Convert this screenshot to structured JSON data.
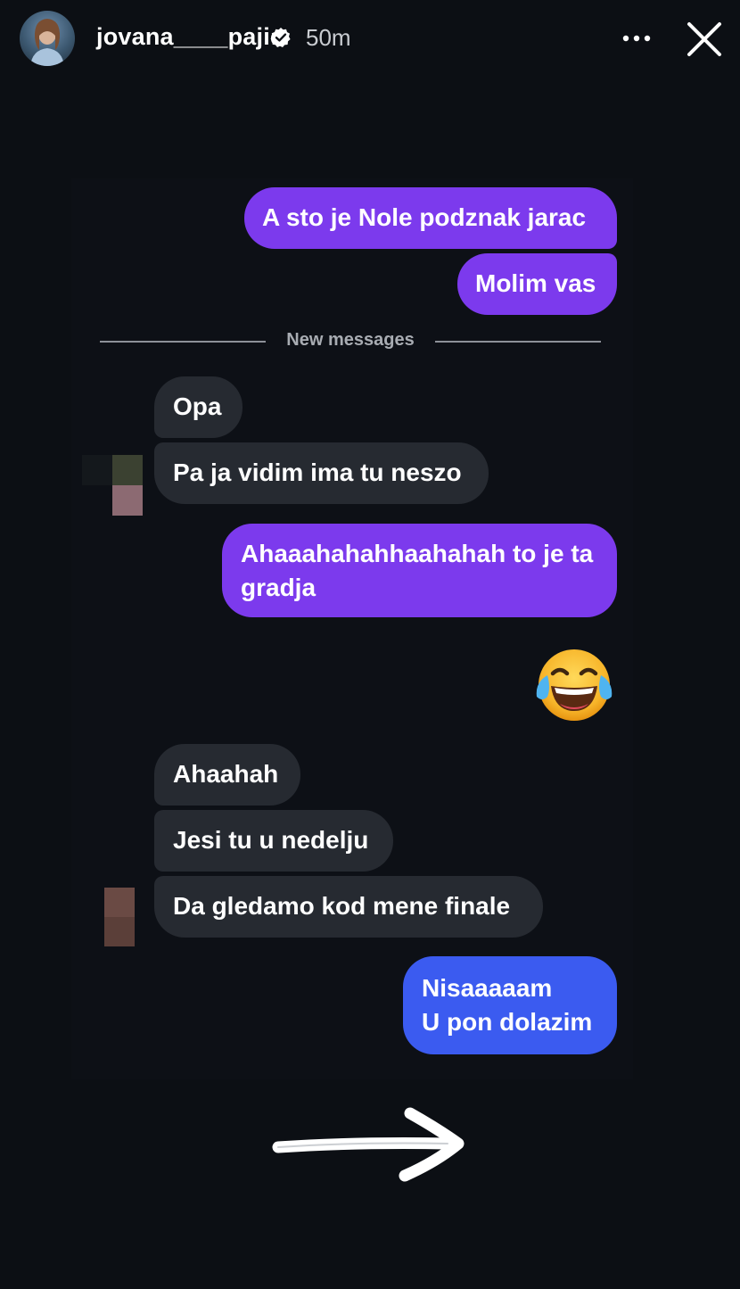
{
  "header": {
    "username": "jovana____pajic",
    "time": "50m",
    "avatar_icon": "profile-photo",
    "verified_icon": "verified-badge-icon",
    "more_icon": "more-dots-icon",
    "close_icon": "close-icon"
  },
  "chat": {
    "divider_label": "New messages",
    "messages": [
      {
        "text": "A sto je Nole podznak jarac",
        "side": "out"
      },
      {
        "text": "Molim vas",
        "side": "out"
      },
      {
        "text": "Opa",
        "side": "in"
      },
      {
        "text": "Pa ja vidim ima tu neszo",
        "side": "in"
      },
      {
        "lines": [
          "Ahaaahahahhaahahah to je ta",
          "gradja"
        ],
        "side": "out"
      },
      {
        "emoji": "face-with-tears-of-joy",
        "side": "out"
      },
      {
        "text": "Ahaahah",
        "side": "in"
      },
      {
        "text": "Jesi tu u nedelju",
        "side": "in"
      },
      {
        "text": "Da gledamo kod mene finale",
        "side": "in"
      },
      {
        "lines": [
          "Nisaaaaam",
          "U pon dolazim"
        ],
        "side": "out"
      }
    ]
  },
  "colors": {
    "background": "#0c0f14",
    "outgoing_purple": "#7c3aed",
    "outgoing_blue": "#3b5bf0",
    "incoming": "#262a31",
    "text": "#ffffff"
  },
  "decoration": {
    "arrow_icon": "hand-drawn-arrow-right"
  }
}
